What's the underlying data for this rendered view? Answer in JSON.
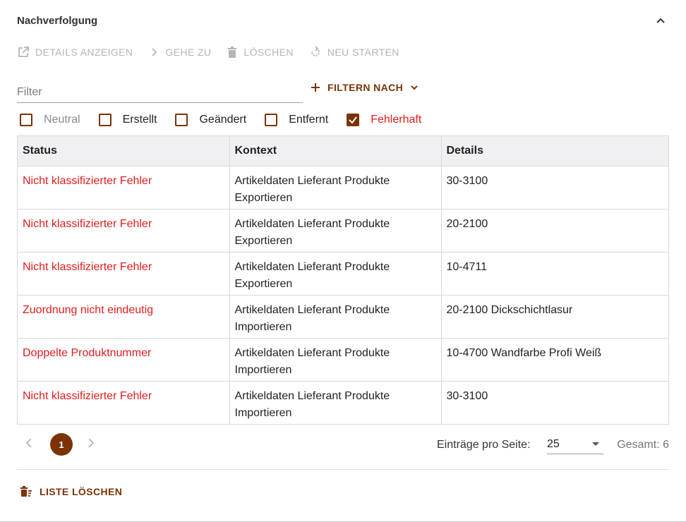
{
  "header": {
    "title": "Nachverfolgung"
  },
  "toolbar": {
    "details": "DETAILS ANZEIGEN",
    "goto": "GEHE ZU",
    "delete": "LÖSCHEN",
    "restart": "NEU STARTEN"
  },
  "filter": {
    "placeholder": "Filter",
    "filter_by": "FILTERN NACH"
  },
  "checkboxes": [
    {
      "label": "Neutral",
      "checked": false
    },
    {
      "label": "Erstellt",
      "checked": false
    },
    {
      "label": "Geändert",
      "checked": false
    },
    {
      "label": "Entfernt",
      "checked": false
    },
    {
      "label": "Fehlerhaft",
      "checked": true
    }
  ],
  "table": {
    "columns": [
      "Status",
      "Kontext",
      "Details"
    ],
    "rows": [
      {
        "status": "Nicht klassifizierter Fehler",
        "context_1": "Artikeldaten Lieferant Produkte",
        "context_2": "Exportieren",
        "details": "30-3100"
      },
      {
        "status": "Nicht klassifizierter Fehler",
        "context_1": "Artikeldaten Lieferant Produkte",
        "context_2": "Exportieren",
        "details": "20-2100"
      },
      {
        "status": "Nicht klassifizierter Fehler",
        "context_1": "Artikeldaten Lieferant Produkte",
        "context_2": "Exportieren",
        "details": "10-4711"
      },
      {
        "status": "Zuordnung nicht eindeutig",
        "context_1": "Artikeldaten Lieferant Produkte",
        "context_2": "Importieren",
        "details": "20-2100 Dickschichtlasur"
      },
      {
        "status": "Doppelte Produktnummer",
        "context_1": "Artikeldaten Lieferant Produkte",
        "context_2": "Importieren",
        "details": "10-4700 Wandfarbe Profi Weiß"
      },
      {
        "status": "Nicht klassifizierter Fehler",
        "context_1": "Artikeldaten Lieferant Produkte",
        "context_2": "Importieren",
        "details": "30-3100"
      }
    ]
  },
  "pagination": {
    "page": "1",
    "per_page_label": "Einträge pro Seite:",
    "per_page_value": "25",
    "total": "Gesamt: 6"
  },
  "footer": {
    "clear_label": "LISTE LÖSCHEN"
  },
  "colors": {
    "accent": "#7b3306",
    "error": "#e01d1d",
    "disabled": "#b5b5b5"
  }
}
